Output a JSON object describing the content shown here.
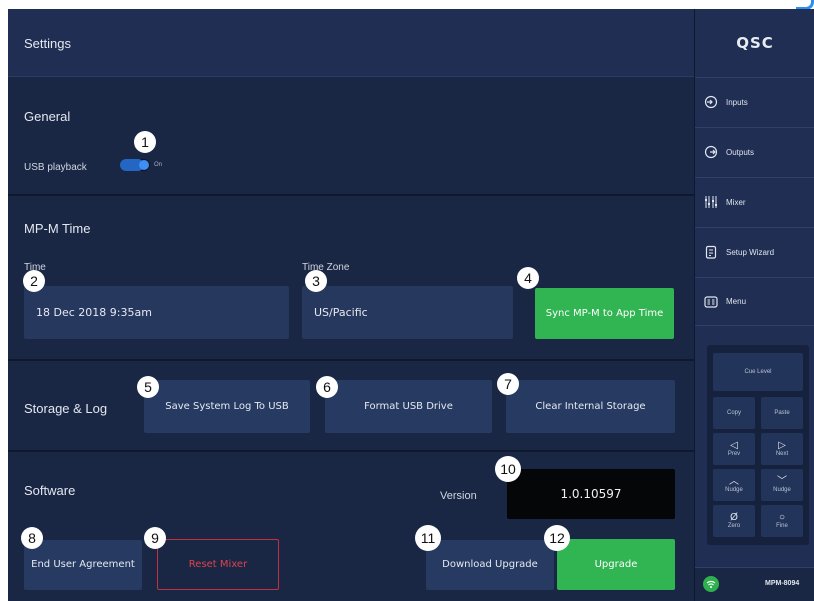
{
  "header": {
    "title": "Settings"
  },
  "general": {
    "title": "General",
    "usb_playback_label": "USB playback",
    "usb_playback_state": "On"
  },
  "time": {
    "title": "MP-M Time",
    "time_label": "Time",
    "time_value": "18 Dec 2018 9:35am",
    "zone_label": "Time Zone",
    "zone_value": "US/Pacific",
    "sync_button": "Sync MP-M to App Time"
  },
  "storage": {
    "title": "Storage & Log",
    "save_log_button": "Save System Log To USB",
    "format_usb_button": "Format USB Drive",
    "clear_storage_button": "Clear Internal Storage"
  },
  "software": {
    "title": "Software",
    "version_label": "Version",
    "version_value": "1.0.10597",
    "eula_button": "End User Agreement",
    "reset_button": "Reset Mixer",
    "download_button": "Download Upgrade",
    "upgrade_button": "Upgrade"
  },
  "callouts": [
    "1",
    "2",
    "3",
    "4",
    "5",
    "6",
    "7",
    "8",
    "9",
    "10",
    "11",
    "12"
  ],
  "sidebar": {
    "logo": "QSC",
    "items": [
      {
        "label": "Inputs",
        "icon": "inputs-icon"
      },
      {
        "label": "Outputs",
        "icon": "outputs-icon"
      },
      {
        "label": "Mixer",
        "icon": "mixer-icon"
      },
      {
        "label": "Setup Wizard",
        "icon": "setup-wizard-icon"
      },
      {
        "label": "Menu",
        "icon": "menu-icon"
      }
    ],
    "keypad": {
      "cue_level": "Cue Level",
      "copy": "Copy",
      "paste": "Paste",
      "prev": "Prev",
      "next": "Next",
      "nudge_up": "Nudge",
      "nudge_down": "Nudge",
      "zero": "Zero",
      "fine": "Fine"
    },
    "device_name": "MPM-8094"
  },
  "colors": {
    "panel": "#1a2744",
    "header": "#1f2e52",
    "field": "#26385e",
    "green": "#30b552",
    "red": "#c1323e",
    "accent_blue": "#3f8ff2"
  }
}
